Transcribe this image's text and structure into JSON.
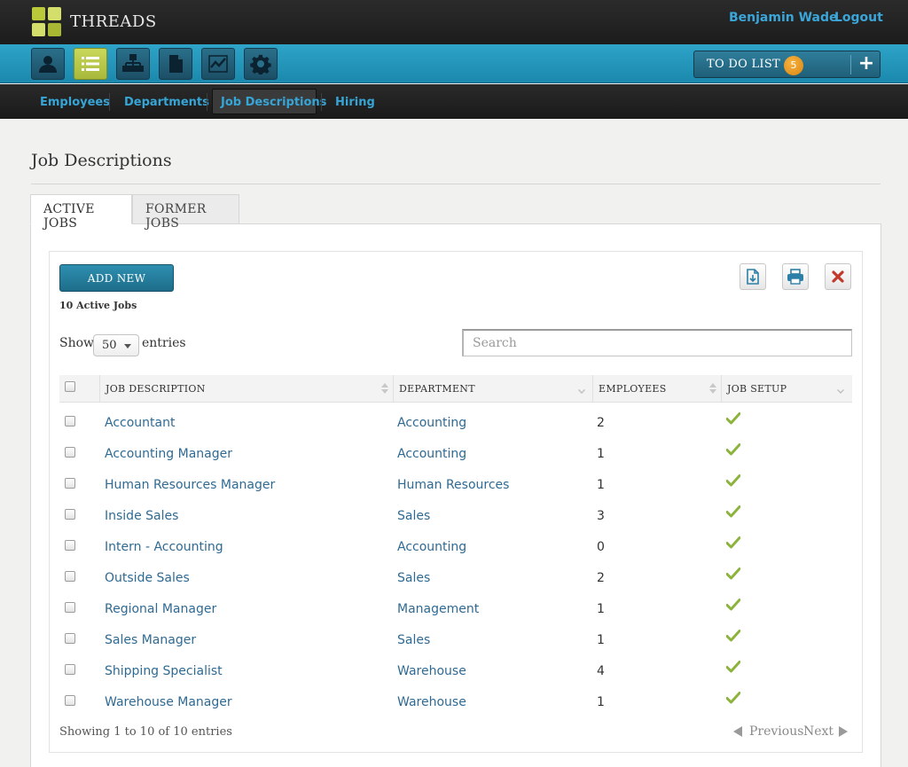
{
  "app": {
    "brand": "THREADS",
    "user_name": "Benjamin Wade",
    "logout": "Logout"
  },
  "toolbar": {
    "todo_label": "TO DO LIST",
    "todo_count": "5",
    "todo_add": "+"
  },
  "subnav": {
    "items": [
      "Employees",
      "Departments",
      "Job Descriptions",
      "Hiring"
    ],
    "active": "Job Descriptions"
  },
  "page": {
    "title": "Job Descriptions",
    "tabs": [
      "ACTIVE JOBS",
      "FORMER JOBS"
    ],
    "add_new": "ADD NEW",
    "active_count_label": "10 Active Jobs",
    "show_label": "Show",
    "page_size": "50",
    "entries_label": "entries",
    "search_placeholder": "Search"
  },
  "table": {
    "columns": [
      "JOB DESCRIPTION",
      "DEPARTMENT",
      "EMPLOYEES",
      "JOB SETUP"
    ],
    "rows": [
      {
        "job": "Accountant",
        "department": "Accounting",
        "employees": "2",
        "setup": true
      },
      {
        "job": "Accounting Manager",
        "department": "Accounting",
        "employees": "1",
        "setup": true
      },
      {
        "job": "Human Resources Manager",
        "department": "Human Resources",
        "employees": "1",
        "setup": true
      },
      {
        "job": "Inside Sales",
        "department": "Sales",
        "employees": "3",
        "setup": true
      },
      {
        "job": "Intern - Accounting",
        "department": "Accounting",
        "employees": "0",
        "setup": true
      },
      {
        "job": "Outside Sales",
        "department": "Sales",
        "employees": "2",
        "setup": true
      },
      {
        "job": "Regional Manager",
        "department": "Management",
        "employees": "1",
        "setup": true
      },
      {
        "job": "Sales Manager",
        "department": "Sales",
        "employees": "1",
        "setup": true
      },
      {
        "job": "Shipping Specialist",
        "department": "Warehouse",
        "employees": "4",
        "setup": true
      },
      {
        "job": "Warehouse Manager",
        "department": "Warehouse",
        "employees": "1",
        "setup": true
      }
    ]
  },
  "pagination": {
    "info": "Showing 1 to 10 of 10 entries",
    "previous": "Previous",
    "next": "Next"
  },
  "colors": {
    "accent": "#1b88ad",
    "active_nav": "#b9c93a",
    "link": "#2f6a93",
    "check": "#8cb43c",
    "delete": "#c0392b"
  },
  "icons": [
    "person-icon",
    "list-icon",
    "org-chart-icon",
    "document-icon",
    "chart-icon",
    "gear-icon",
    "export-icon",
    "print-icon",
    "delete-icon",
    "check-icon"
  ]
}
